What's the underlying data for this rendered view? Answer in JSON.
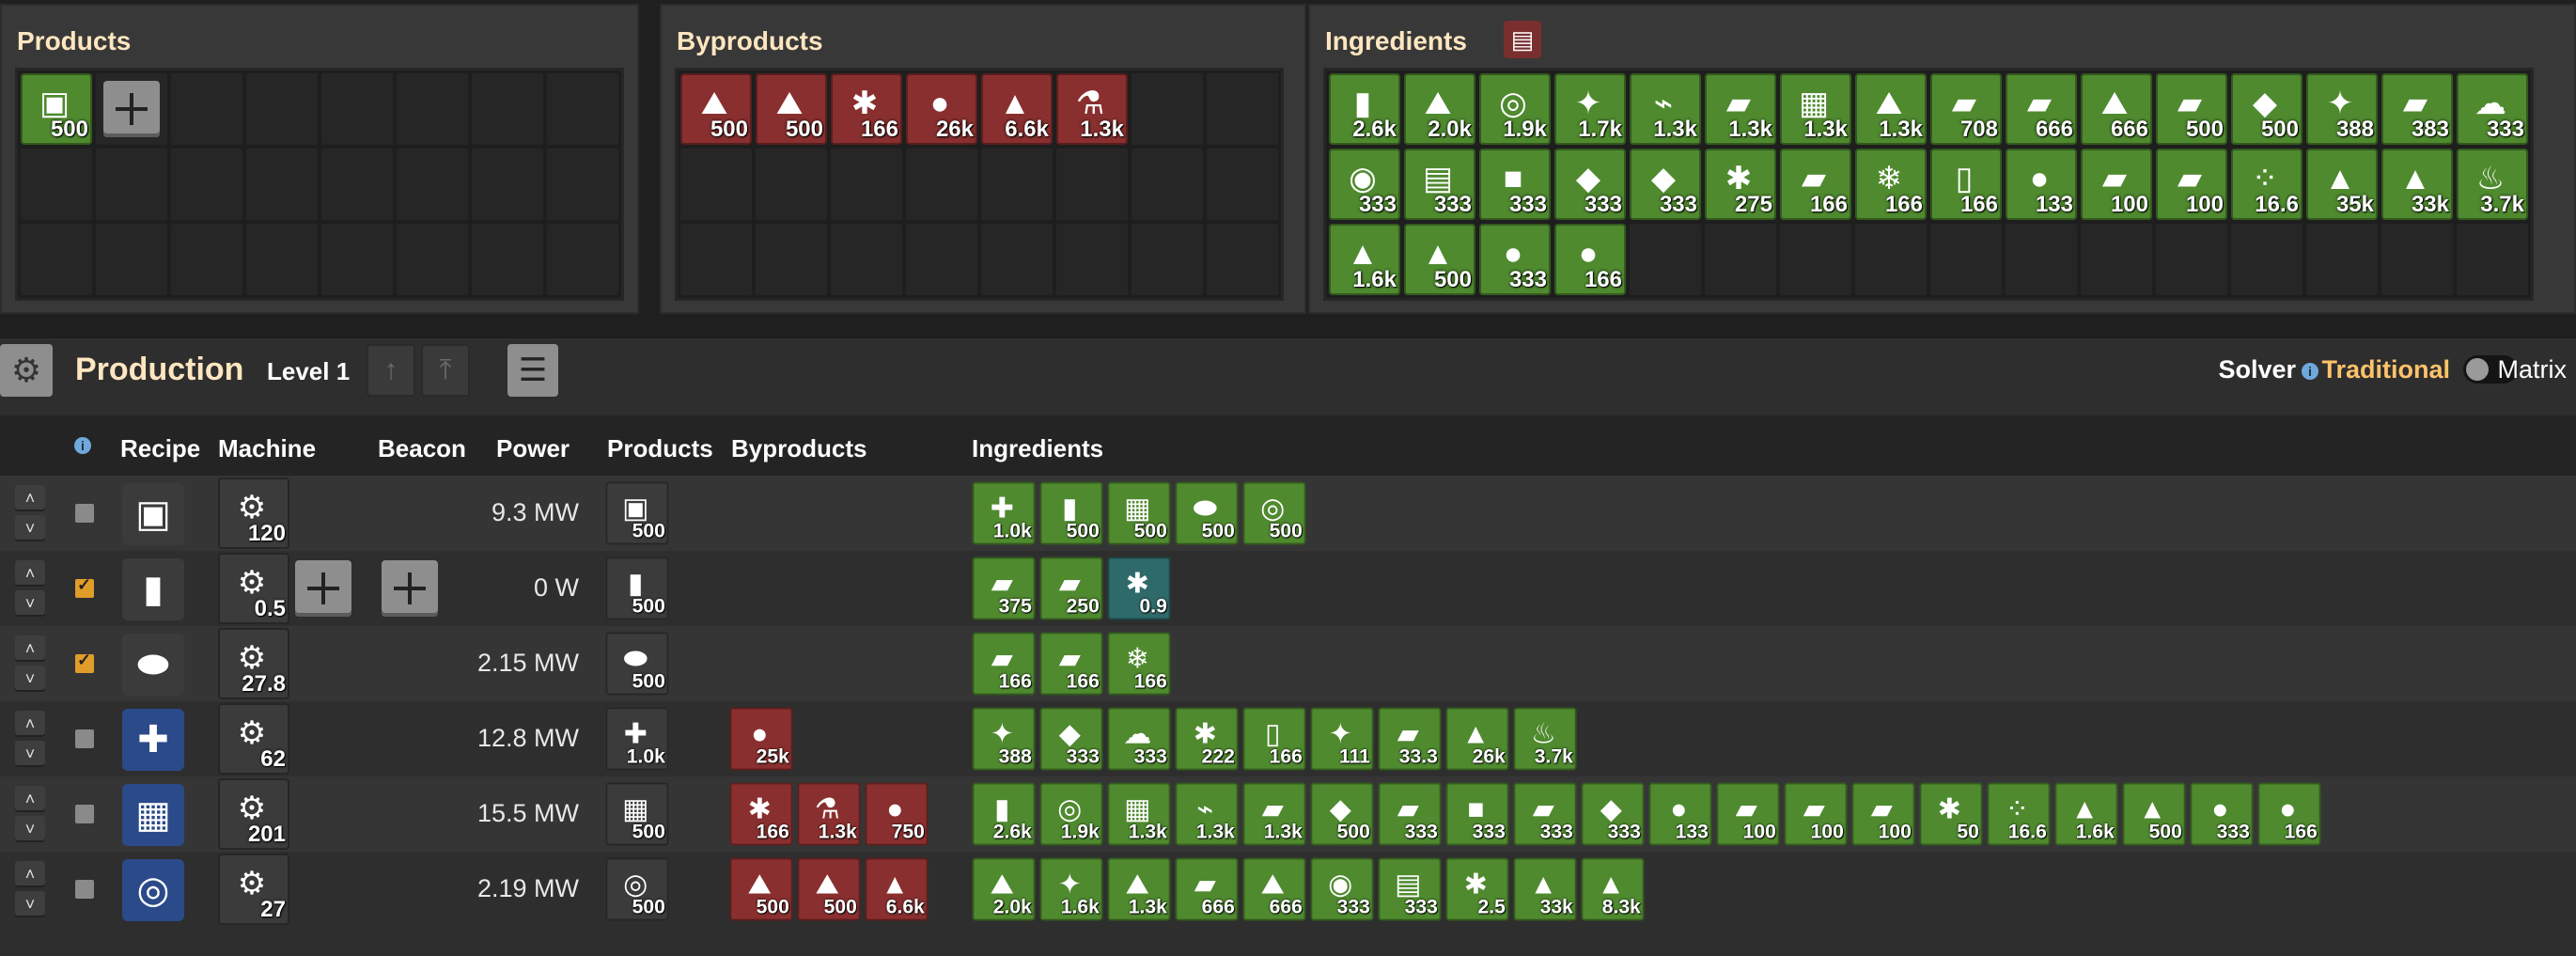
{
  "panels": {
    "products": {
      "title": "Products",
      "items": [
        {
          "icon": "circuit-icon",
          "glyph": "▣",
          "count": "500",
          "color": "green"
        }
      ]
    },
    "byproducts": {
      "title": "Byproducts",
      "items": [
        {
          "icon": "sand-pile-icon",
          "glyph": "⛰",
          "count": "500"
        },
        {
          "icon": "stone-pile-icon",
          "glyph": "⛰",
          "count": "500"
        },
        {
          "icon": "scrap-icon",
          "glyph": "✱",
          "count": "166"
        },
        {
          "icon": "purple-orb-icon",
          "glyph": "●",
          "count": "26k"
        },
        {
          "icon": "blue-cone-icon",
          "glyph": "▲",
          "count": "6.6k"
        },
        {
          "icon": "flask-icon",
          "glyph": "⚗",
          "count": "1.3k"
        }
      ]
    },
    "ingredients": {
      "title": "Ingredients",
      "items": [
        {
          "icon": "canister-icon",
          "glyph": "▮",
          "count": "2.6k"
        },
        {
          "icon": "ore-pile-icon",
          "glyph": "⛰",
          "count": "2.0k"
        },
        {
          "icon": "copper-wire-icon",
          "glyph": "◎",
          "count": "1.9k"
        },
        {
          "icon": "gold-ore-icon",
          "glyph": "✦",
          "count": "1.7k"
        },
        {
          "icon": "resistor-icon",
          "glyph": "⌁",
          "count": "1.3k"
        },
        {
          "icon": "green-plate-icon",
          "glyph": "▰",
          "count": "1.3k"
        },
        {
          "icon": "board-icon",
          "glyph": "▦",
          "count": "1.3k"
        },
        {
          "icon": "white-powder-icon",
          "glyph": "⛰",
          "count": "1.3k"
        },
        {
          "icon": "gold-plate-icon",
          "glyph": "▰",
          "count": "708"
        },
        {
          "icon": "dark-plate-icon",
          "glyph": "▰",
          "count": "666"
        },
        {
          "icon": "salt-pile-icon",
          "glyph": "⛰",
          "count": "666"
        },
        {
          "icon": "copper-plate-icon",
          "glyph": "▰",
          "count": "500"
        },
        {
          "icon": "rubber-icon",
          "glyph": "◆",
          "count": "500"
        },
        {
          "icon": "crystal-icon",
          "glyph": "✦",
          "count": "388"
        },
        {
          "icon": "wood-icon",
          "glyph": "▰",
          "count": "383"
        },
        {
          "icon": "cotton-icon",
          "glyph": "☁",
          "count": "333"
        },
        {
          "icon": "coil-icon",
          "glyph": "◉",
          "count": "333"
        },
        {
          "icon": "phone-icon",
          "glyph": "▤",
          "count": "333"
        },
        {
          "icon": "grey-plate-icon",
          "glyph": "■",
          "count": "333"
        },
        {
          "icon": "pink-plate-icon",
          "glyph": "◆",
          "count": "333"
        },
        {
          "icon": "pink-sheet-icon",
          "glyph": "◆",
          "count": "333"
        },
        {
          "icon": "coal-icon",
          "glyph": "✱",
          "count": "275"
        },
        {
          "icon": "glass-icon",
          "glyph": "▰",
          "count": "166"
        },
        {
          "icon": "ice-icon",
          "glyph": "❄",
          "count": "166"
        },
        {
          "icon": "jar-icon",
          "glyph": "▯",
          "count": "166"
        },
        {
          "icon": "iron-ore-icon",
          "glyph": "●",
          "count": "133"
        },
        {
          "icon": "dark-sheet-icon",
          "glyph": "▰",
          "count": "100"
        },
        {
          "icon": "brown-sheet-icon",
          "glyph": "▰",
          "count": "100"
        },
        {
          "icon": "pebbles-icon",
          "glyph": "⁘",
          "count": "16.6"
        },
        {
          "icon": "blue-cone-icon",
          "glyph": "▲",
          "count": "35k"
        },
        {
          "icon": "yellow-cone-icon",
          "glyph": "▲",
          "count": "33k"
        },
        {
          "icon": "flame-icon",
          "glyph": "♨",
          "count": "3.7k"
        },
        {
          "icon": "brown-cone-icon",
          "glyph": "▲",
          "count": "1.6k"
        },
        {
          "icon": "gold-cone-icon",
          "glyph": "▲",
          "count": "500"
        },
        {
          "icon": "green-sphere-icon",
          "glyph": "●",
          "count": "333"
        },
        {
          "icon": "green-dots-icon",
          "glyph": "●",
          "count": "166"
        }
      ]
    }
  },
  "production": {
    "title": "Production",
    "level": "Level 1",
    "solver_label": "Solver",
    "traditional_label": "Traditional",
    "matrix_label": "Matrix",
    "headers": {
      "info": "i",
      "recipe": "Recipe",
      "machine": "Machine",
      "beacon": "Beacon",
      "power": "Power",
      "products": "Products",
      "byproducts": "Byproducts",
      "ingredients": "Ingredients"
    },
    "rows": [
      {
        "checked": false,
        "recipe_icon": "circuit-icon",
        "recipe_glyph": "▣",
        "machine_count": "120",
        "power": "9.3 MW",
        "products": [
          {
            "glyph": "▣",
            "count": "500"
          }
        ],
        "byproducts": [],
        "ingredients": [
          {
            "glyph": "✚",
            "count": "1.0k"
          },
          {
            "glyph": "▮",
            "count": "500"
          },
          {
            "glyph": "▦",
            "count": "500"
          },
          {
            "glyph": "⬬",
            "count": "500"
          },
          {
            "glyph": "◎",
            "count": "500"
          }
        ]
      },
      {
        "checked": true,
        "recipe_icon": "canister-icon",
        "recipe_glyph": "▮",
        "machine_count": "0.5",
        "power": "0 W",
        "products": [
          {
            "glyph": "▮",
            "count": "500"
          }
        ],
        "byproducts": [],
        "ingredients": [
          {
            "glyph": "▰",
            "count": "375"
          },
          {
            "glyph": "▰",
            "count": "250"
          },
          {
            "glyph": "✱",
            "count": "0.9",
            "teal": true
          }
        ]
      },
      {
        "checked": true,
        "recipe_icon": "capacitor-icon",
        "recipe_glyph": "⬬",
        "machine_count": "27.8",
        "power": "2.15 MW",
        "products": [
          {
            "glyph": "⬬",
            "count": "500"
          }
        ],
        "byproducts": [],
        "ingredients": [
          {
            "glyph": "▰",
            "count": "166"
          },
          {
            "glyph": "▰",
            "count": "166"
          },
          {
            "glyph": "❄",
            "count": "166"
          }
        ]
      },
      {
        "checked": false,
        "recipe_icon": "dynamite-icon",
        "recipe_glyph": "✚",
        "machine_count": "62",
        "power": "12.8 MW",
        "products": [
          {
            "glyph": "✚",
            "count": "1.0k"
          }
        ],
        "byproducts": [
          {
            "glyph": "●",
            "count": "25k"
          }
        ],
        "ingredients": [
          {
            "glyph": "✦",
            "count": "388"
          },
          {
            "glyph": "◆",
            "count": "333"
          },
          {
            "glyph": "☁",
            "count": "333"
          },
          {
            "glyph": "✱",
            "count": "222"
          },
          {
            "glyph": "▯",
            "count": "166"
          },
          {
            "glyph": "✦",
            "count": "111"
          },
          {
            "glyph": "▰",
            "count": "33.3"
          },
          {
            "glyph": "▲",
            "count": "26k"
          },
          {
            "glyph": "♨",
            "count": "3.7k"
          }
        ]
      },
      {
        "checked": false,
        "recipe_icon": "board-icon",
        "recipe_glyph": "▦",
        "machine_count": "201",
        "power": "15.5 MW",
        "products": [
          {
            "glyph": "▦",
            "count": "500"
          }
        ],
        "byproducts": [
          {
            "glyph": "✱",
            "count": "166"
          },
          {
            "glyph": "⚗",
            "count": "1.3k"
          },
          {
            "glyph": "●",
            "count": "750"
          }
        ],
        "ingredients": [
          {
            "glyph": "▮",
            "count": "2.6k"
          },
          {
            "glyph": "◎",
            "count": "1.9k"
          },
          {
            "glyph": "▦",
            "count": "1.3k"
          },
          {
            "glyph": "⌁",
            "count": "1.3k"
          },
          {
            "glyph": "▰",
            "count": "1.3k"
          },
          {
            "glyph": "◆",
            "count": "500"
          },
          {
            "glyph": "▰",
            "count": "333"
          },
          {
            "glyph": "■",
            "count": "333"
          },
          {
            "glyph": "▰",
            "count": "333"
          },
          {
            "glyph": "◆",
            "count": "333"
          },
          {
            "glyph": "●",
            "count": "133"
          },
          {
            "glyph": "▰",
            "count": "100"
          },
          {
            "glyph": "▰",
            "count": "100"
          },
          {
            "glyph": "▰",
            "count": "100"
          },
          {
            "glyph": "✱",
            "count": "50"
          },
          {
            "glyph": "⁘",
            "count": "16.6"
          },
          {
            "glyph": "▲",
            "count": "1.6k"
          },
          {
            "glyph": "▲",
            "count": "500"
          },
          {
            "glyph": "●",
            "count": "333"
          },
          {
            "glyph": "●",
            "count": "166"
          }
        ]
      },
      {
        "checked": false,
        "recipe_icon": "chip-icon",
        "recipe_glyph": "◎",
        "machine_count": "27",
        "power": "2.19 MW",
        "products": [
          {
            "glyph": "◎",
            "count": "500"
          }
        ],
        "byproducts": [
          {
            "glyph": "⛰",
            "count": "500"
          },
          {
            "glyph": "⛰",
            "count": "500"
          },
          {
            "glyph": "▲",
            "count": "6.6k"
          }
        ],
        "ingredients": [
          {
            "glyph": "⛰",
            "count": "2.0k"
          },
          {
            "glyph": "✦",
            "count": "1.6k"
          },
          {
            "glyph": "⛰",
            "count": "1.3k"
          },
          {
            "glyph": "▰",
            "count": "666"
          },
          {
            "glyph": "⛰",
            "count": "666"
          },
          {
            "glyph": "◉",
            "count": "333"
          },
          {
            "glyph": "▤",
            "count": "333"
          },
          {
            "glyph": "✱",
            "count": "2.5"
          },
          {
            "glyph": "▲",
            "count": "33k"
          },
          {
            "glyph": "▲",
            "count": "8.3k"
          }
        ]
      }
    ]
  },
  "colors": {
    "accent": "#ffe6c0",
    "solver_active": "#ffc36a",
    "slot_green": "#4f8a2f",
    "slot_red": "#8a2f2f",
    "checkbox_on": "#e09d2a"
  }
}
